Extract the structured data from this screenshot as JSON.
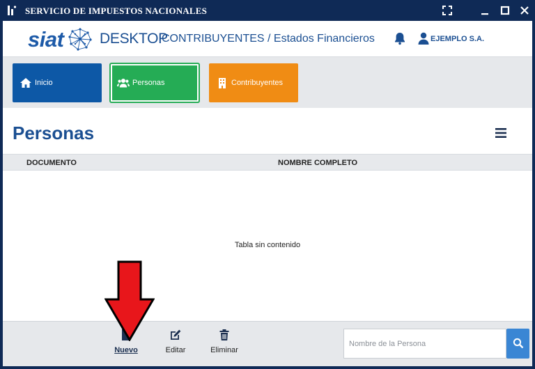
{
  "window": {
    "title": "SERVICIO DE IMPUESTOS NACIONALES",
    "icons": {
      "app": "siat-app-icon",
      "fullscreen": "fullscreen-icon",
      "minimize": "minimize-icon",
      "maximize": "maximize-icon",
      "close": "close-icon"
    }
  },
  "header": {
    "logo_text": "siat",
    "app_name": "DESKTOP",
    "section": "CONTRIBUYENTES / Estados Financieros",
    "user_name": "EJEMPLO S.A.",
    "icons": {
      "notifications": "bell-icon",
      "user": "user-icon"
    }
  },
  "tiles": [
    {
      "label": "Inicio",
      "icon": "home-icon",
      "color": "#0d58a6"
    },
    {
      "label": "Personas",
      "icon": "users-icon",
      "color": "#25ac55"
    },
    {
      "label": "Contribuyentes",
      "icon": "building-icon",
      "color": "#f08c14"
    }
  ],
  "page": {
    "title": "Personas",
    "menu_icon": "hamburger-menu-icon"
  },
  "table": {
    "columns": [
      "DOCUMENTO",
      "NOMBRE COMPLETO"
    ],
    "rows": [],
    "empty_message": "Tabla sin contenido"
  },
  "toolbar": {
    "buttons": [
      {
        "label": "Nuevo",
        "icon": "new-file-icon"
      },
      {
        "label": "Editar",
        "icon": "edit-icon"
      },
      {
        "label": "Eliminar",
        "icon": "trash-icon"
      }
    ],
    "search": {
      "placeholder": "Nombre de la Persona",
      "value": "",
      "icon": "search-icon"
    }
  },
  "annotation": {
    "icon": "red-arrow-down-icon",
    "color": "#e8161b"
  },
  "colors": {
    "titlebar": "#0f2a56",
    "brand_blue": "#1b4f92",
    "search_button": "#3a86d4"
  }
}
